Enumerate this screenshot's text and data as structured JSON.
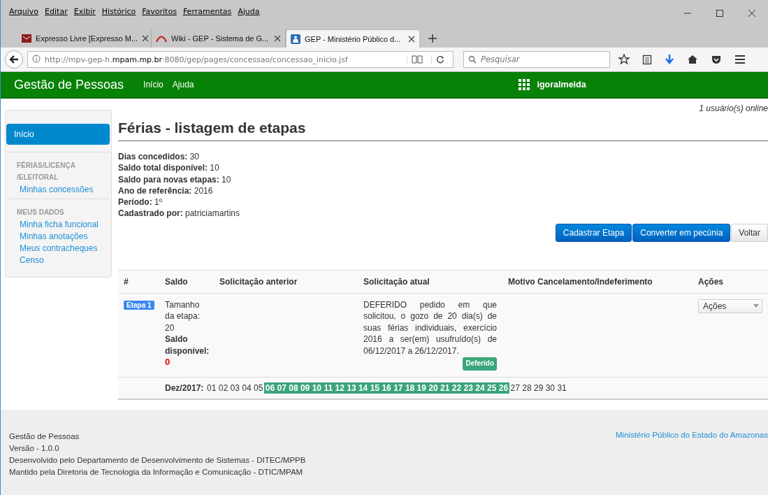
{
  "menu_bar": [
    "Arquivo",
    "Editar",
    "Exibir",
    "Histórico",
    "Favoritos",
    "Ferramentas",
    "Ajuda"
  ],
  "browser_tabs": [
    {
      "title": "Expresso Livre [Expresso M...",
      "selected": false
    },
    {
      "title": "Wiki - GEP - Sistema de G...",
      "selected": false
    },
    {
      "title": "GEP - Ministério Público d...",
      "selected": true
    }
  ],
  "address_bar": {
    "url": "http://mpv-gep-h.**mpam.mp.br**:8080/gep/pages/concessao/concessao_inicio.jsf"
  },
  "search": {
    "placeholder": "Pesquisar"
  },
  "navbar": {
    "brand": "Gestão de Pessoas",
    "links": [
      "Início",
      "Ajuda"
    ],
    "user": "igoralmeida"
  },
  "sidebar": {
    "items": [
      {
        "kind": "link",
        "label": "Início",
        "selected": true
      },
      {
        "kind": "header",
        "label": "FÉRIAS/LICENÇA /ELEITORAL"
      },
      {
        "kind": "link",
        "label": "Minhas concessões",
        "selected": false
      },
      {
        "kind": "header",
        "label": "MEUS DADOS"
      },
      {
        "kind": "link",
        "label": "Minha ficha funcional",
        "selected": false
      },
      {
        "kind": "link",
        "label": "Minhas anotações",
        "selected": false
      },
      {
        "kind": "link",
        "label": "Meus contracheques",
        "selected": false
      },
      {
        "kind": "link",
        "label": "Censo",
        "selected": false
      }
    ]
  },
  "online": "1 usuário(s) online",
  "title": "Férias - listagem de etapas",
  "details": [
    "**Dias concedidos:** 30",
    "**Saldo total disponível:** 10",
    "**Saldo para novas etapas:** 10",
    "**Ano de referência:** 2016",
    "**Período:** 1º",
    "**Cadastrado por:** patriciamartins"
  ],
  "buttons": [
    {
      "label": "Cadastrar Etapa",
      "kind": "primary"
    },
    {
      "label": "Converter em pecúnia",
      "kind": "primary"
    },
    {
      "label": "Voltar",
      "kind": "default"
    }
  ],
  "table": {
    "columns": [
      "#",
      "Saldo",
      "Solicitação anterior",
      "Solicitação atual",
      "Motivo Cancelamento/Indeferimento",
      "Ações"
    ],
    "rows": [
      {
        "stage": "Etapa 1",
        "size_label": "Tamanho da etapa:",
        "size": "20",
        "balance_label": "Saldo disponível:",
        "balance": "0",
        "current": "DEFERIDO pedido em que solicitou, o gozo de 20 dia(s) de suas férias individuais, exercício 2016 a ser(em) usufruído(s) de 06/12/2017 a 26/12/2017.",
        "status": "Deferido",
        "actions": "Ações",
        "month": "Dez/2017:",
        "days": [
          {
            "label": "01",
            "selected": false
          },
          {
            "label": "02",
            "selected": false
          },
          {
            "label": "03",
            "selected": false
          },
          {
            "label": "04",
            "selected": false
          },
          {
            "label": "05",
            "selected": false
          },
          {
            "label": "06",
            "selected": true
          },
          {
            "label": "07",
            "selected": true
          },
          {
            "label": "08",
            "selected": true
          },
          {
            "label": "09",
            "selected": true
          },
          {
            "label": "10",
            "selected": true
          },
          {
            "label": "11",
            "selected": true
          },
          {
            "label": "12",
            "selected": true
          },
          {
            "label": "13",
            "selected": true
          },
          {
            "label": "14",
            "selected": true
          },
          {
            "label": "15",
            "selected": true
          },
          {
            "label": "16",
            "selected": true
          },
          {
            "label": "17",
            "selected": true
          },
          {
            "label": "18",
            "selected": true
          },
          {
            "label": "19",
            "selected": true
          },
          {
            "label": "20",
            "selected": true
          },
          {
            "label": "21",
            "selected": true
          },
          {
            "label": "22",
            "selected": true
          },
          {
            "label": "23",
            "selected": true
          },
          {
            "label": "24",
            "selected": true
          },
          {
            "label": "25",
            "selected": true
          },
          {
            "label": "26",
            "selected": true
          },
          {
            "label": "27",
            "selected": false
          },
          {
            "label": "28",
            "selected": false
          },
          {
            "label": "29",
            "selected": false
          },
          {
            "label": "30",
            "selected": false
          },
          {
            "label": "31",
            "selected": false
          }
        ]
      }
    ]
  },
  "footer": {
    "lines": [
      "Gestão de Pessoas",
      "Versão - 1.0.0",
      "Desenvolvido pelo Departamento de Desenvolvimento de Sistemas - DITEC/MPPB",
      "Mantido pela Diretoria de Tecnologia da Informação e Comunicação - DTIC/MPAM"
    ],
    "link": "Ministério Público do Estado do Amazonas"
  }
}
